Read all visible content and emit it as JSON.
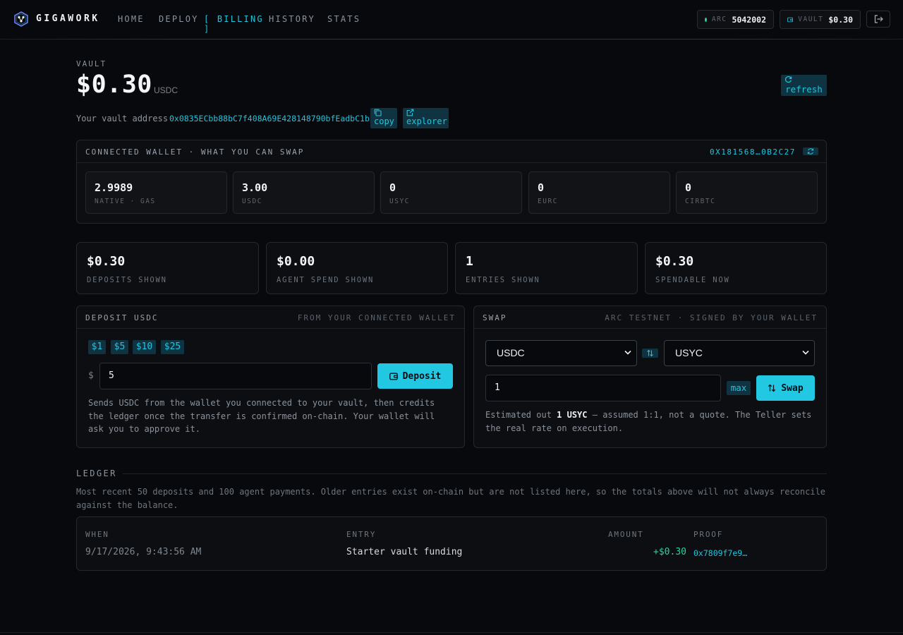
{
  "colors": {
    "accent": "#22c5de",
    "positive": "#2ad49a",
    "background": "#08090c"
  },
  "nav": {
    "brand": "GIGAWORK",
    "items": [
      {
        "label": "HOME"
      },
      {
        "label": "DEPLOY"
      },
      {
        "label": "BILLING",
        "active": true
      },
      {
        "label": "HISTORY"
      },
      {
        "label": "STATS"
      }
    ],
    "arc_label": "ARC",
    "arc_value": "5042002",
    "vault_label": "VAULT",
    "vault_value": "$0.30",
    "icons": [
      "hex-logo-icon",
      "wallet-icon",
      "logout-icon"
    ]
  },
  "vault": {
    "eyebrow": "VAULT",
    "amount": "$0.30",
    "unit": "USDC",
    "refresh_label": "refresh",
    "address_label": "Your vault address",
    "address": "0x0835ECbb88bC7f408A69E428148790bfEadbC1bb",
    "copy_label": "copy",
    "explorer_label": "explorer"
  },
  "wallet": {
    "title": "CONNECTED WALLET · WHAT YOU CAN SWAP",
    "address": "0X181568…0B2C27",
    "balances": [
      {
        "value": "2.9989",
        "label": "NATIVE · GAS"
      },
      {
        "value": "3.00",
        "label": "USDC"
      },
      {
        "value": "0",
        "label": "USYC"
      },
      {
        "value": "0",
        "label": "EURC"
      },
      {
        "value": "0",
        "label": "CIRBTC"
      }
    ]
  },
  "stats": [
    {
      "value": "$0.30",
      "label": "DEPOSITS SHOWN"
    },
    {
      "value": "$0.00",
      "label": "AGENT SPEND SHOWN"
    },
    {
      "value": "1",
      "label": "ENTRIES SHOWN"
    },
    {
      "value": "$0.30",
      "label": "SPENDABLE NOW"
    }
  ],
  "deposit": {
    "title": "DEPOSIT USDC",
    "subtitle": "FROM YOUR CONNECTED WALLET",
    "quick": [
      "$1",
      "$5",
      "$10",
      "$25"
    ],
    "currency_symbol": "$",
    "amount_value": "5",
    "button_label": "Deposit",
    "note": "Sends USDC from the wallet you connected to your vault, then credits the ledger once the transfer is confirmed on-chain. Your wallet will ask you to approve it."
  },
  "swap": {
    "title": "SWAP",
    "subtitle": "ARC TESTNET · SIGNED BY YOUR WALLET",
    "from_token": "USDC",
    "to_token": "USYC",
    "amount_value": "1",
    "max_label": "max",
    "button_label": "Swap",
    "estimate_prefix": "Estimated out",
    "estimate_value": "1 USYC",
    "estimate_suffix": "— assumed 1:1, not a quote. The Teller sets the real rate on execution."
  },
  "ledger": {
    "title": "LEDGER",
    "note": "Most recent 50 deposits and 100 agent payments. Older entries exist on-chain but are not listed here, so the totals above will not always reconcile against the balance.",
    "columns": [
      "WHEN",
      "ENTRY",
      "AMOUNT",
      "PROOF"
    ],
    "rows": [
      {
        "when": "9/17/2026, 9:43:56 AM",
        "entry": "Starter vault funding",
        "amount": "+$0.30",
        "proof": "0x7809f7e9…"
      }
    ]
  }
}
